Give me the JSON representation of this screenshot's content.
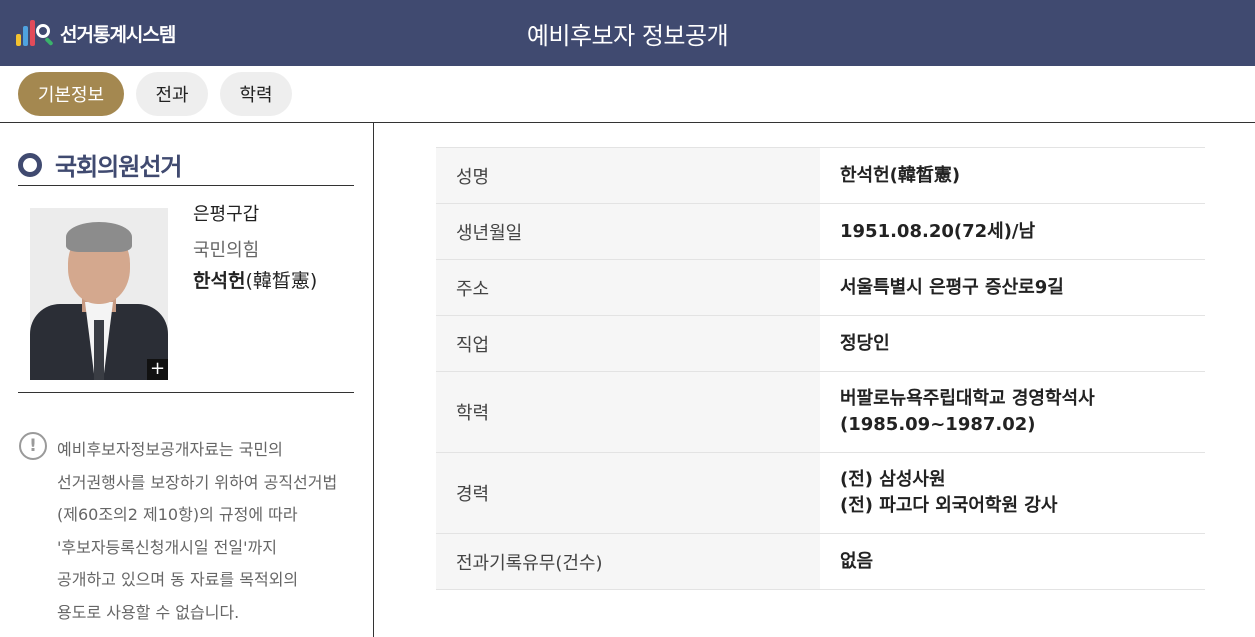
{
  "header": {
    "logo_text": "선거통계시스템",
    "title": "예비후보자 정보공개"
  },
  "tabs": [
    {
      "label": "기본정보",
      "active": true
    },
    {
      "label": "전과",
      "active": false
    },
    {
      "label": "학력",
      "active": false
    }
  ],
  "left": {
    "section_title": "국회의원선거",
    "district": "은평구갑",
    "party": "국민의힘",
    "name_main": "한석헌",
    "name_hanja": "(韓晳憲)",
    "notice_lines": [
      "예비후보자정보공개자료는 국민의",
      "선거권행사를 보장하기 위하여 공직선거법",
      "(제60조의2 제10항)의 규정에 따라",
      "'후보자등록신청개시일 전일'까지",
      "공개하고 있으며 동 자료를 목적외의",
      "용도로 사용할 수 없습니다."
    ]
  },
  "table": {
    "rows": [
      {
        "label": "성명",
        "value": [
          "한석헌(韓晳憲)"
        ]
      },
      {
        "label": "생년월일",
        "value": [
          "1951.08.20(72세)/남"
        ]
      },
      {
        "label": "주소",
        "value": [
          "서울특별시 은평구 증산로9길"
        ]
      },
      {
        "label": "직업",
        "value": [
          "정당인"
        ]
      },
      {
        "label": "학력",
        "value": [
          "버팔로뉴욕주립대학교 경영학석사",
          "(1985.09~1987.02)"
        ]
      },
      {
        "label": "경력",
        "value": [
          "(전) 삼성사원",
          "(전) 파고다 외국어학원 강사"
        ]
      },
      {
        "label": "전과기록유무(건수)",
        "value": [
          "없음"
        ]
      }
    ]
  },
  "colors": {
    "header_bg": "#404a70",
    "tab_active": "#a48850",
    "tab_inactive": "#eeeeee",
    "label_bg": "#f6f6f6"
  }
}
